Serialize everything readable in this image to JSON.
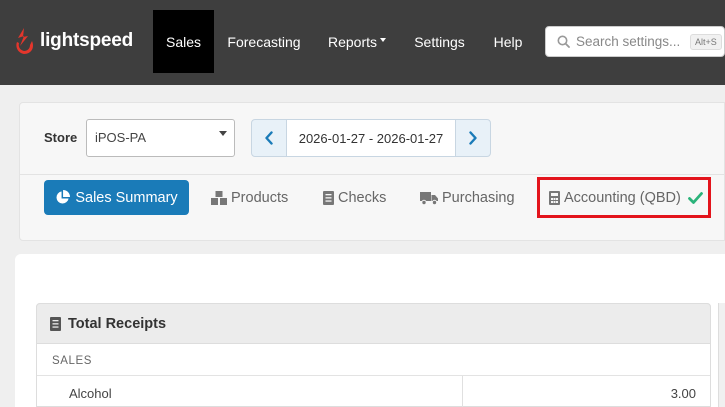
{
  "brand": {
    "name": "lightspeed",
    "color": "#e4362c"
  },
  "nav": {
    "items": [
      {
        "label": "Sales",
        "active": true
      },
      {
        "label": "Forecasting"
      },
      {
        "label": "Reports"
      },
      {
        "label": "Settings"
      },
      {
        "label": "Help"
      }
    ],
    "search": {
      "placeholder": "Search settings...",
      "shortcut": "Alt+S"
    }
  },
  "filters": {
    "store_label": "Store",
    "store_value": "iPOS-PA",
    "date_range": "2026-01-27 - 2026-01-27"
  },
  "tabs": {
    "sales_summary": "Sales Summary",
    "products": "Products",
    "checks": "Checks",
    "purchasing": "Purchasing",
    "accounting": "Accounting (QBD)",
    "accent": "#1a7bb8",
    "check_color": "#2bb37a",
    "highlight_color": "#e3141c"
  },
  "receipts": {
    "title": "Total Receipts",
    "section": "SALES",
    "rows": [
      {
        "name": "Alcohol",
        "value": "3.00"
      }
    ]
  }
}
